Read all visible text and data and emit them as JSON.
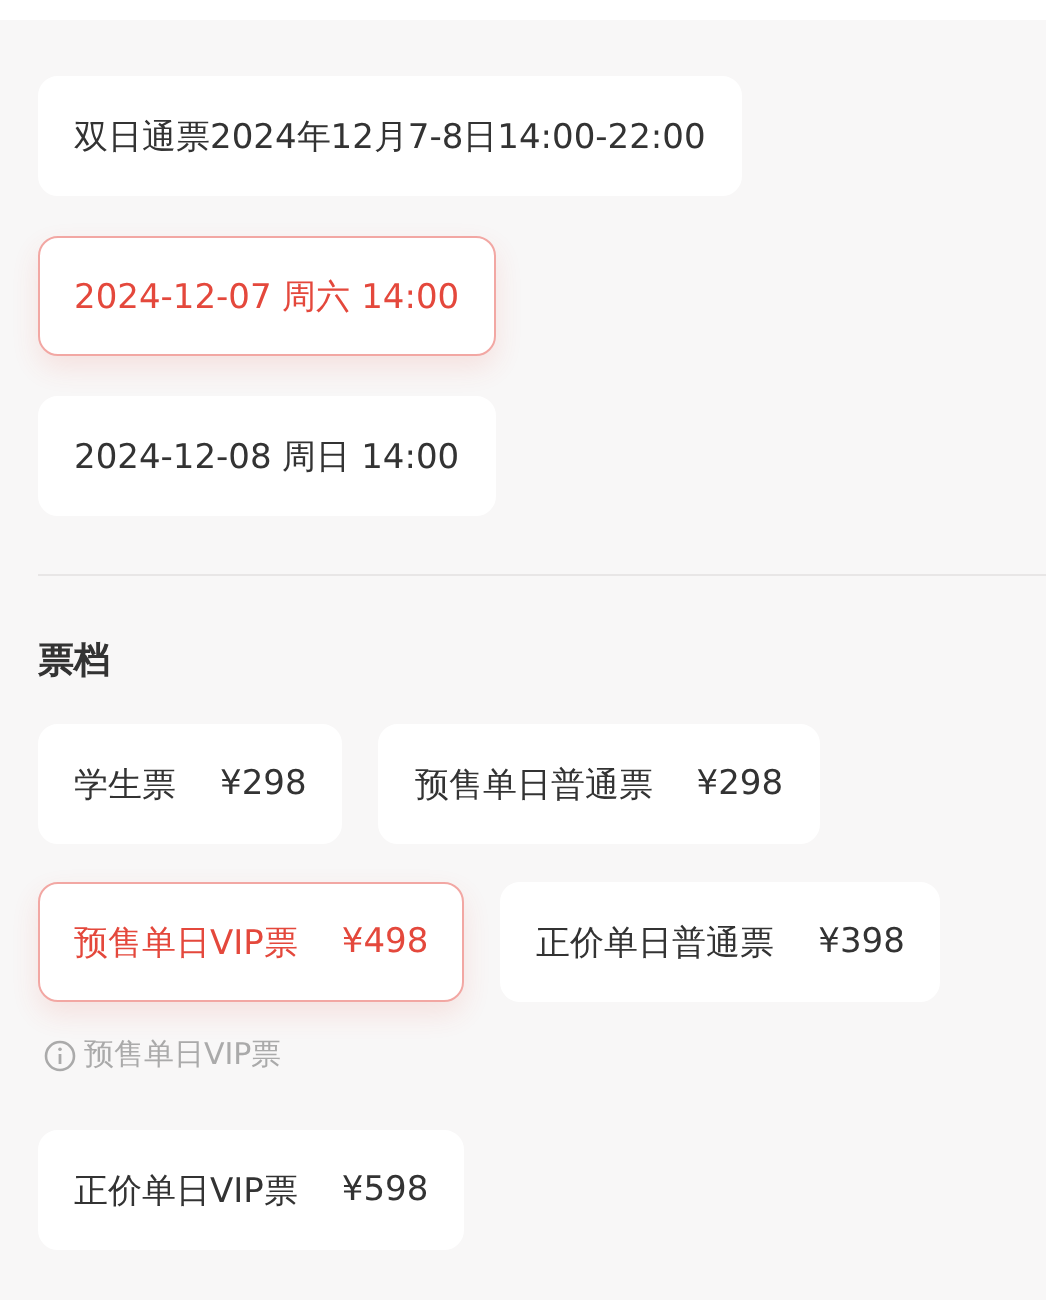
{
  "sessions": [
    {
      "label": "双日通票2024年12月7-8日14:00-22:00",
      "selected": false
    },
    {
      "label": "2024-12-07 周六 14:00",
      "selected": true
    },
    {
      "label": "2024-12-08 周日 14:00",
      "selected": false
    }
  ],
  "tickets": {
    "title": "票档",
    "rows": [
      {
        "items": [
          {
            "name": "学生票",
            "price": "¥298",
            "selected": false
          },
          {
            "name": "预售单日普通票",
            "price": "¥298",
            "selected": false
          }
        ]
      },
      {
        "items": [
          {
            "name": "预售单日VIP票",
            "price": "¥498",
            "selected": true
          },
          {
            "name": "正价单日普通票",
            "price": "¥398",
            "selected": false
          }
        ],
        "note": "预售单日VIP票"
      },
      {
        "items": [
          {
            "name": "正价单日VIP票",
            "price": "¥598",
            "selected": false
          }
        ]
      }
    ]
  }
}
